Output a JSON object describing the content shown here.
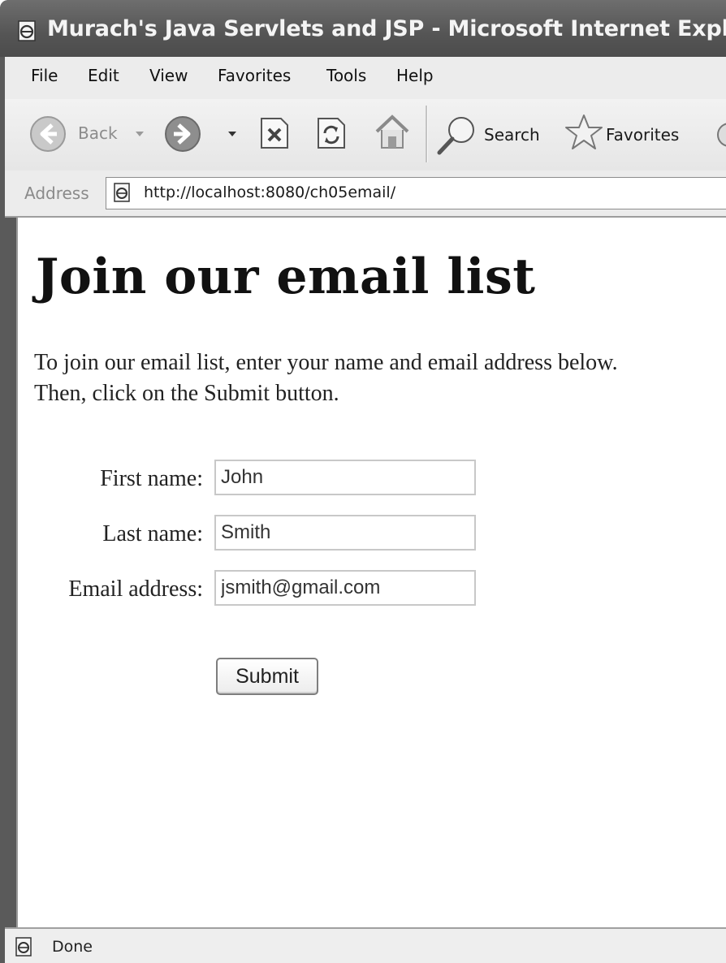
{
  "window": {
    "title": "Murach's Java Servlets and JSP - Microsoft Internet Explorer"
  },
  "menu": {
    "items": [
      "File",
      "Edit",
      "View",
      "Favorites",
      "Tools",
      "Help"
    ]
  },
  "toolbar": {
    "back_label": "Back",
    "search_label": "Search",
    "favorites_label": "Favorites"
  },
  "address": {
    "label": "Address",
    "url": "http://localhost:8080/ch05email/"
  },
  "page": {
    "heading": "Join our email list",
    "intro_line1": "To join our email list, enter your name and email address below.",
    "intro_line2": "Then, click on the Submit button.",
    "first_name_label": "First name:",
    "first_name_value": "John",
    "last_name_label": "Last name:",
    "last_name_value": "Smith",
    "email_label": "Email address:",
    "email_value": "jsmith@gmail.com",
    "submit_label": "Submit"
  },
  "status": {
    "text": "Done"
  }
}
